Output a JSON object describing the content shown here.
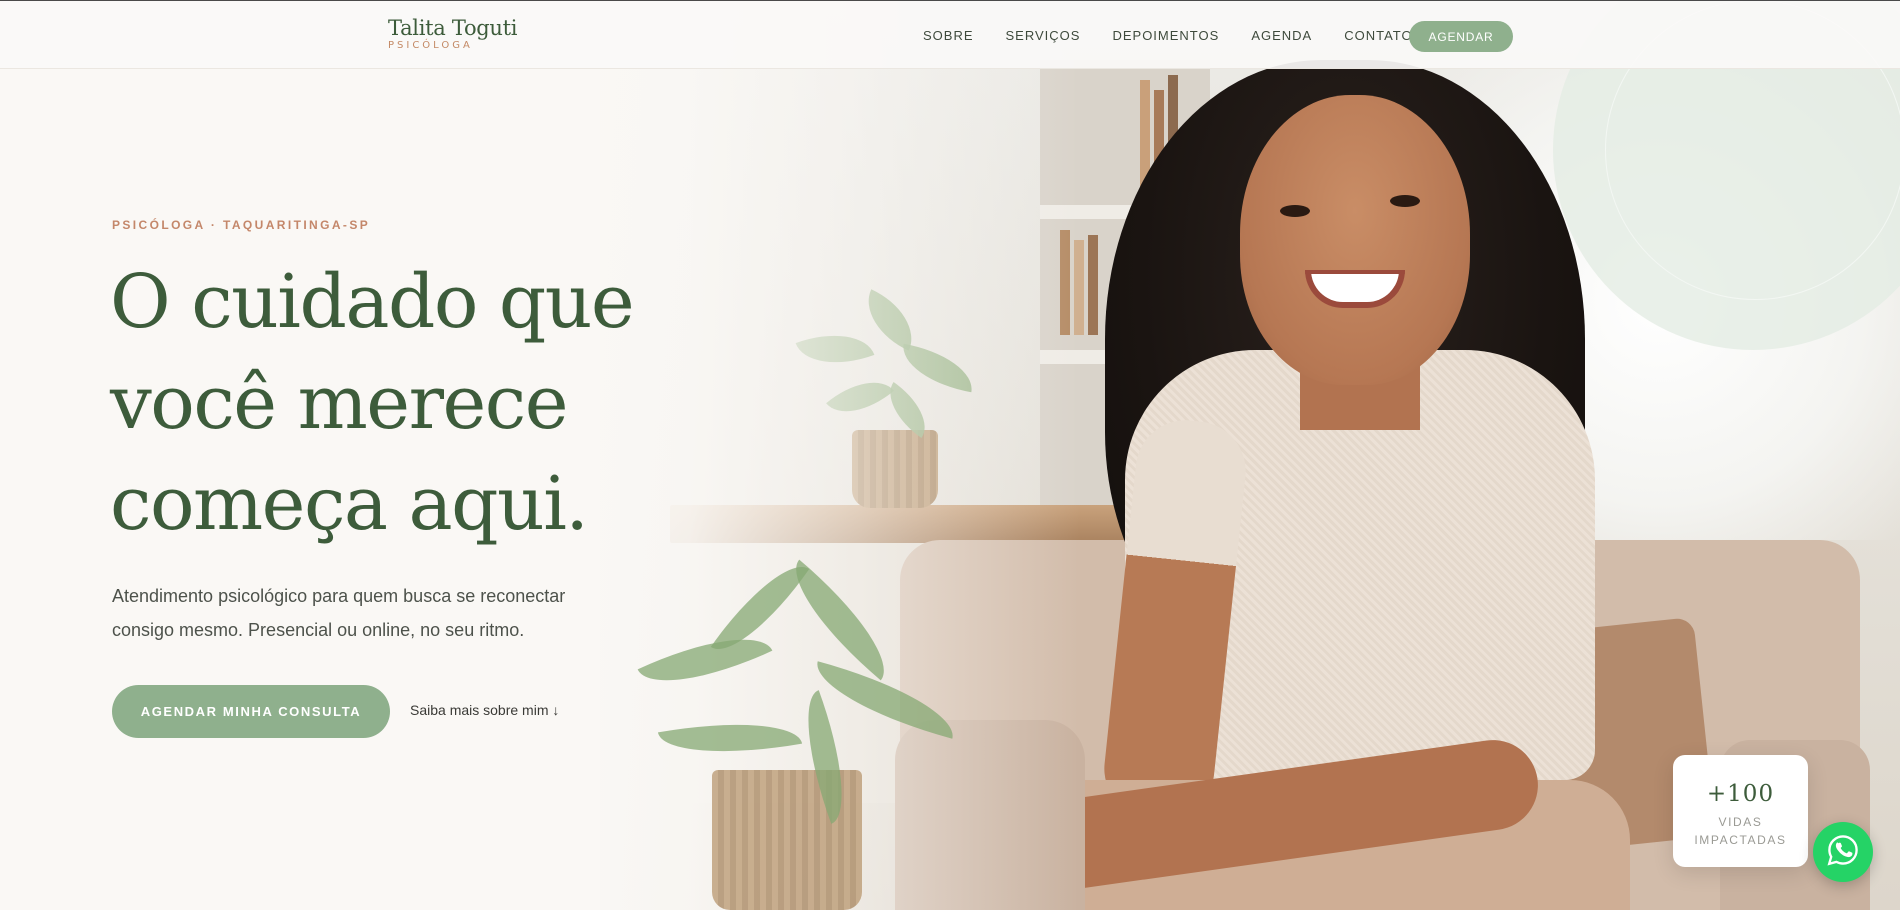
{
  "brand": {
    "name": "Talita Toguti",
    "role": "PSICÓLOGA"
  },
  "nav": {
    "links": [
      "SOBRE",
      "SERVIÇOS",
      "DEPOIMENTOS",
      "AGENDA",
      "CONTATO"
    ],
    "cta": "AGENDAR"
  },
  "hero": {
    "eyebrow": "PSICÓLOGA · TAQUARITINGA-SP",
    "headline": [
      "O cuidado que",
      "você merece",
      "começa aqui."
    ],
    "subtext": "Atendimento psicológico para quem busca se reconectar consigo mesmo. Presencial ou online, no seu ritmo.",
    "primary_cta": "AGENDAR MINHA CONSULTA",
    "secondary_cta": "Saiba mais sobre mim ↓"
  },
  "stat": {
    "number": "+100",
    "label": "VIDAS IMPACTADAS"
  },
  "icons": {
    "whatsapp": "whatsapp-icon"
  },
  "colors": {
    "primary_green": "#3d5c3b",
    "button_green": "#8fb08d",
    "accent_terracotta": "#c4876a",
    "background": "#faf8f5",
    "whatsapp": "#25d366"
  }
}
